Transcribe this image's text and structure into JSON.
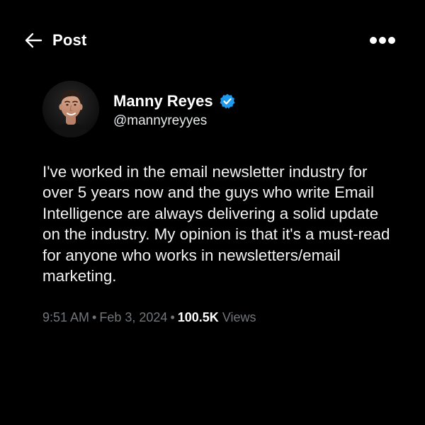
{
  "header": {
    "title": "Post",
    "back_icon": "arrow-left-icon",
    "more_icon": "more-horizontal-icon"
  },
  "author": {
    "name": "Manny Reyes",
    "handle": "@mannyreyyes",
    "verified": true,
    "verified_icon": "verified-badge-icon",
    "avatar_icon": "avatar-photo"
  },
  "post": {
    "text": "I've worked in the email newsletter industry for over 5 years now and the guys who write Email Intelligence are always delivering a solid update on the industry. My opinion is that it's a must-read for anyone who works in newsletters/email marketing."
  },
  "meta": {
    "time": "9:51 AM",
    "separator": "•",
    "date": "Feb 3, 2024",
    "views_count": "100.5K",
    "views_label": "Views"
  },
  "colors": {
    "background": "#000000",
    "text_primary": "#ffffff",
    "text_secondary": "#71767b",
    "verified_blue": "#1d9bf0"
  }
}
